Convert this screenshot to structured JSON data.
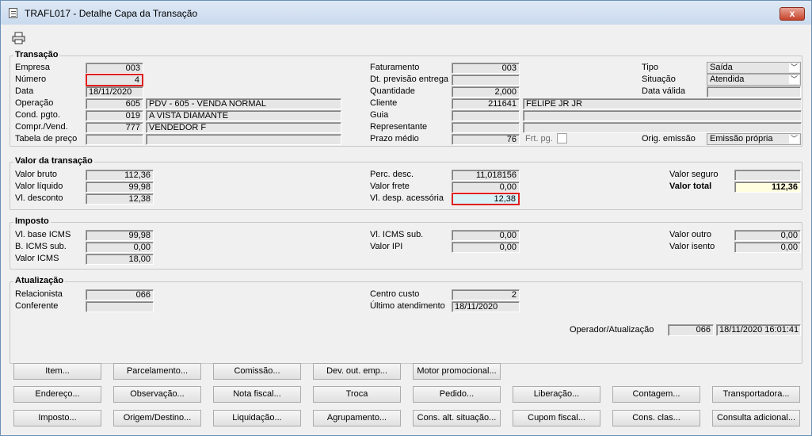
{
  "window": {
    "title": "TRAFL017 - Detalhe Capa da Transação",
    "close": "x"
  },
  "transacao": {
    "title": "Transação",
    "empresa_label": "Empresa",
    "empresa": "003",
    "numero_label": "Número",
    "numero": "4",
    "data_label": "Data",
    "data": "18/11/2020",
    "operacao_label": "Operação",
    "operacao_cod": "605",
    "operacao_desc": "PDV - 605 - VENDA NORMAL",
    "cond_label": "Cond. pgto.",
    "cond_cod": "019",
    "cond_desc": "A VISTA DIAMANTE",
    "compr_label": "Compr./Vend.",
    "compr_cod": "777",
    "compr_desc": "VENDEDOR F",
    "tabela_label": "Tabela de preço",
    "tabela_cod": "",
    "tabela_desc": "",
    "faturamento_label": "Faturamento",
    "faturamento": "003",
    "dtprev_label": "Dt. previsão entrega",
    "dtprev": "",
    "quantidade_label": "Quantidade",
    "quantidade": "2,000",
    "cliente_label": "Cliente",
    "cliente_cod": "211641",
    "cliente_nome": "FELIPE JR JR",
    "guia_label": "Guia",
    "guia": "",
    "representante_label": "Representante",
    "representante": "",
    "prazo_label": "Prazo médio",
    "prazo": "76",
    "frt_label": "Frt. pg.",
    "tipo_label": "Tipo",
    "tipo": "Saída",
    "situacao_label": "Situação",
    "situacao": "Atendida",
    "datavalida_label": "Data válida",
    "datavalida": "",
    "orig_label": "Orig. emissão",
    "orig": "Emissão própria"
  },
  "valor": {
    "title": "Valor da transação",
    "bruto_label": "Valor bruto",
    "bruto": "112,36",
    "liquido_label": "Valor líquido",
    "liquido": "99,98",
    "desconto_label": "Vl. desconto",
    "desconto": "12,38",
    "percdesc_label": "Perc. desc.",
    "percdesc": "11,018156",
    "frete_label": "Valor frete",
    "frete": "0,00",
    "despacess_label": "Vl. desp. acessória",
    "despacess": "12,38",
    "seguro_label": "Valor seguro",
    "seguro": "",
    "total_label": "Valor total",
    "total": "112,36"
  },
  "imposto": {
    "title": "Imposto",
    "baseicms_label": "Vl. base ICMS",
    "baseicms": "99,98",
    "bicmssub_label": "B. ICMS sub.",
    "bicmssub": "0,00",
    "valoricms_label": "Valor ICMS",
    "valoricms": "18,00",
    "vlicmssub_label": "Vl. ICMS sub.",
    "vlicmssub": "0,00",
    "valoripi_label": "Valor IPI",
    "valoripi": "0,00",
    "outro_label": "Valor outro",
    "outro": "0,00",
    "isento_label": "Valor isento",
    "isento": "0,00"
  },
  "atualizacao": {
    "title": "Atualização",
    "relacionista_label": "Relacionista",
    "relacionista": "066",
    "conferente_label": "Conferente",
    "conferente": "",
    "centro_label": "Centro custo",
    "centro": "2",
    "ultimo_label": "Último atendimento",
    "ultimo": "18/11/2020",
    "operador_label": "Operador/Atualização",
    "operador": "066",
    "operador_data": "18/11/2020 16:01:41"
  },
  "buttons": {
    "item": "Item...",
    "parcelamento": "Parcelamento...",
    "comissao": "Comissão...",
    "devout": "Dev. out. emp...",
    "motor": "Motor promocional...",
    "endereco": "Endereço...",
    "observacao": "Observação...",
    "notafiscal": "Nota fiscal...",
    "troca": "Troca",
    "pedido": "Pedido...",
    "liberacao": "Liberação...",
    "contagem": "Contagem...",
    "transportadora": "Transportadora...",
    "imposto": "Imposto...",
    "origem": "Origem/Destino...",
    "liquidacao": "Liquidação...",
    "agrupamento": "Agrupamento...",
    "consalt": "Cons. alt. situação...",
    "cupom": "Cupom fiscal...",
    "consclas": "Cons. clas...",
    "consulta": "Consulta adicional..."
  }
}
